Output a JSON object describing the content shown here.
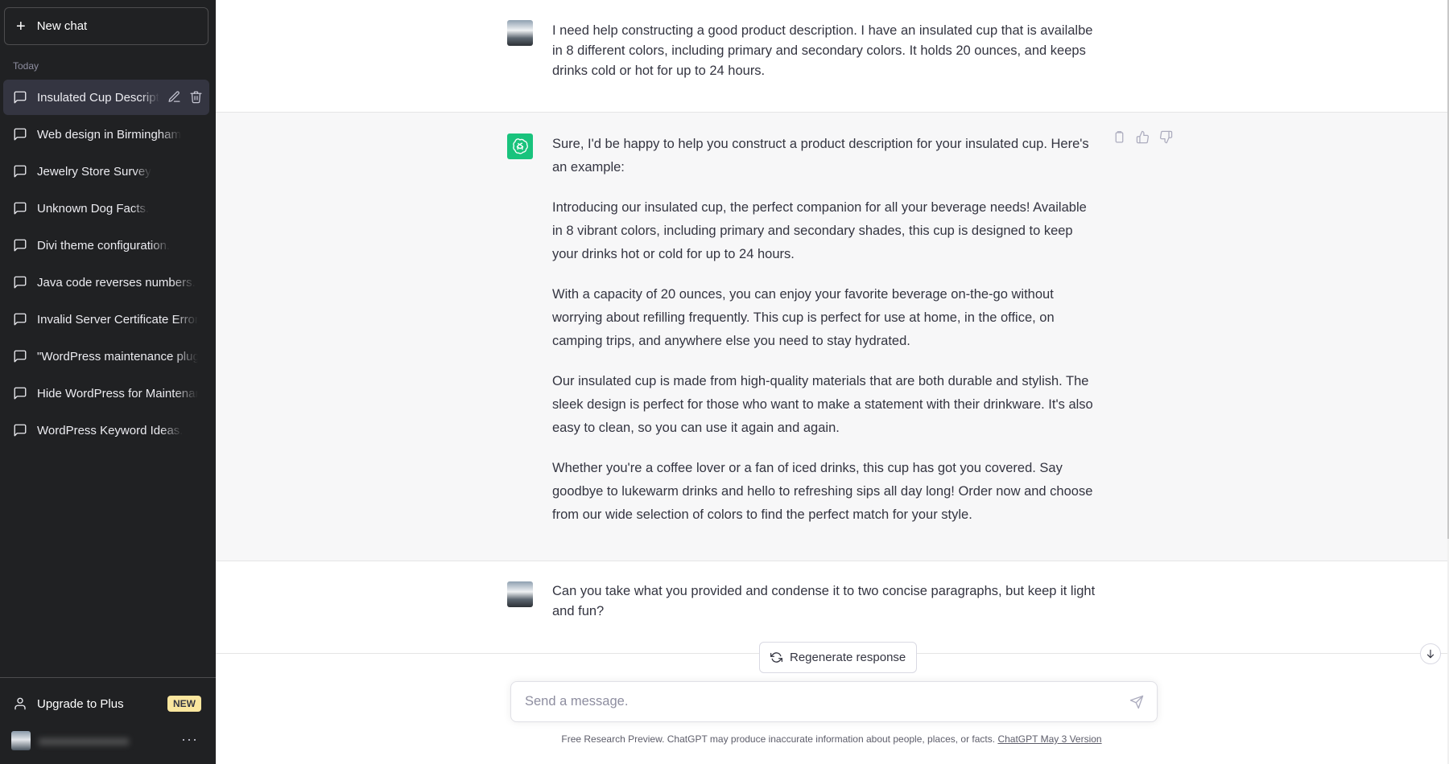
{
  "sidebar": {
    "new_chat_label": "New chat",
    "section_label": "Today",
    "items": [
      {
        "label": "Insulated Cup Descripti"
      },
      {
        "label": "Web design in Birmingham"
      },
      {
        "label": "Jewelry Store Survey"
      },
      {
        "label": "Unknown Dog Facts."
      },
      {
        "label": "Divi theme configuration."
      },
      {
        "label": "Java code reverses numbers."
      },
      {
        "label": "Invalid Server Certificate Error"
      },
      {
        "label": "\"WordPress maintenance plugi"
      },
      {
        "label": "Hide WordPress for Maintenan"
      },
      {
        "label": "WordPress Keyword Ideas."
      }
    ],
    "upgrade_label": "Upgrade to Plus",
    "upgrade_badge": "NEW",
    "account_menu": "···"
  },
  "conversation": {
    "user_message_1": "I need help constructing a good product description. I have an insulated cup that is availalbe in 8 different colors, including primary and secondary colors. It holds 20 ounces, and keeps drinks cold or hot for up to 24 hours.",
    "bot_paragraphs": [
      "Sure, I'd be happy to help you construct a product description for your insulated cup. Here's an example:",
      "Introducing our insulated cup, the perfect companion for all your beverage needs! Available in 8 vibrant colors, including primary and secondary shades, this cup is designed to keep your drinks hot or cold for up to 24 hours.",
      "With a capacity of 20 ounces, you can enjoy your favorite beverage on-the-go without worrying about refilling frequently. This cup is perfect for use at home, in the office, on camping trips, and anywhere else you need to stay hydrated.",
      "Our insulated cup is made from high-quality materials that are both durable and stylish. The sleek design is perfect for those who want to make a statement with their drinkware. It's also easy to clean, so you can use it again and again.",
      "Whether you're a coffee lover or a fan of iced drinks, this cup has got you covered. Say goodbye to lukewarm drinks and hello to refreshing sips all day long! Order now and choose from our wide selection of colors to find the perfect match for your style."
    ],
    "user_message_2": "Can you take what you provided and condense it to two concise paragraphs, but keep it light and fun?"
  },
  "composer": {
    "regenerate_label": "Regenerate response",
    "placeholder": "Send a message.",
    "footer_text": "Free Research Preview. ChatGPT may produce inaccurate information about people, places, or facts.",
    "footer_link": "ChatGPT May 3 Version"
  },
  "colors": {
    "sidebar_bg": "#202123",
    "active_item_bg": "#343541",
    "bot_avatar": "#19c37d",
    "bot_row_bg": "#f7f7f8",
    "badge_bg": "#fae69e"
  }
}
